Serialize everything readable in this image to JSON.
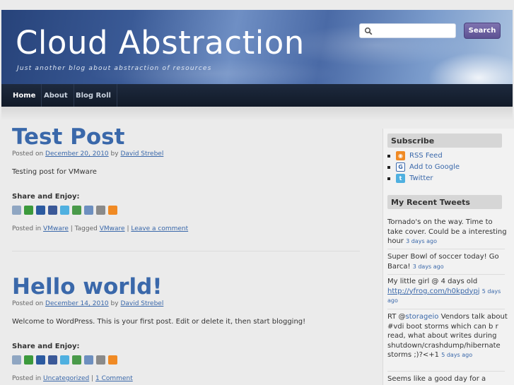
{
  "header": {
    "title": "Cloud Abstraction",
    "tagline": "Just another blog about abstraction of resources",
    "search_placeholder": "",
    "search_button": "Search"
  },
  "nav": [
    {
      "label": "Home"
    },
    {
      "label": "About"
    },
    {
      "label": "Blog Roll"
    }
  ],
  "posts": [
    {
      "title": "Test Post",
      "meta_prefix": "Posted on",
      "date": "December 20, 2010",
      "by": "by",
      "author": "David Strebel",
      "body": "Testing post for VMware",
      "share_label": "Share and Enjoy:",
      "footer_prefix": "Posted in",
      "category": "VMware",
      "tag_sep": "| Tagged",
      "tag": "VMware",
      "comment_sep": "|",
      "comment_link": "Leave a comment"
    },
    {
      "title": "Hello world!",
      "meta_prefix": "Posted on",
      "date": "December 14, 2010",
      "by": "by",
      "author": "David Strebel",
      "body": "Welcome to WordPress. This is your first post. Edit or delete it, then start blogging!",
      "share_label": "Share and Enjoy:",
      "footer_prefix": "Posted in",
      "category": "Uncategorized",
      "comment_sep": "|",
      "comment_link": "1 Comment"
    }
  ],
  "share_icons": [
    {
      "name": "digg-icon",
      "color": "#8fa6c2"
    },
    {
      "name": "stumbleupon-icon",
      "color": "#3c9a3c"
    },
    {
      "name": "delicious-icon",
      "color": "#2c5aa0"
    },
    {
      "name": "facebook-icon",
      "color": "#3b5998"
    },
    {
      "name": "twitter-icon",
      "color": "#4fb0e0"
    },
    {
      "name": "google-icon",
      "color": "#4a9a4a"
    },
    {
      "name": "linkedin-icon",
      "color": "#6d8fbf"
    },
    {
      "name": "reddit-icon",
      "color": "#8a8a8a"
    },
    {
      "name": "rss-icon",
      "color": "#f08a24"
    }
  ],
  "sidebar": {
    "subscribe_title": "Subscribe",
    "subscribe": [
      {
        "label": "RSS Feed",
        "icon": "rss-icon",
        "color": "#f08a24"
      },
      {
        "label": "Add to Google",
        "icon": "google-icon",
        "color": "#3a68aa"
      },
      {
        "label": "Twitter",
        "icon": "twitter-icon",
        "color": "#4fb0e0"
      }
    ],
    "tweets_title": "My Recent Tweets",
    "tweets": [
      {
        "text": "Tornado's on the way. Time to take cover. Could be a interesting hour",
        "ago": "3 days ago"
      },
      {
        "text": "Super Bowl of soccer today! Go Barca!",
        "ago": "3 days ago"
      },
      {
        "text": "My little girl @ 4 days old",
        "link": "http://yfrog.com/h0kpdypj",
        "ago": "5 days ago"
      },
      {
        "text_pre": "RT @",
        "mention": "storageio",
        "text": "Vendors talk about #vdi boot storms which can b r read, what about writes during shutdown/crashdump/hibernate storms ;)?<+1",
        "ago": "5 days ago"
      },
      {
        "text": "Seems like a good day for a"
      }
    ]
  }
}
